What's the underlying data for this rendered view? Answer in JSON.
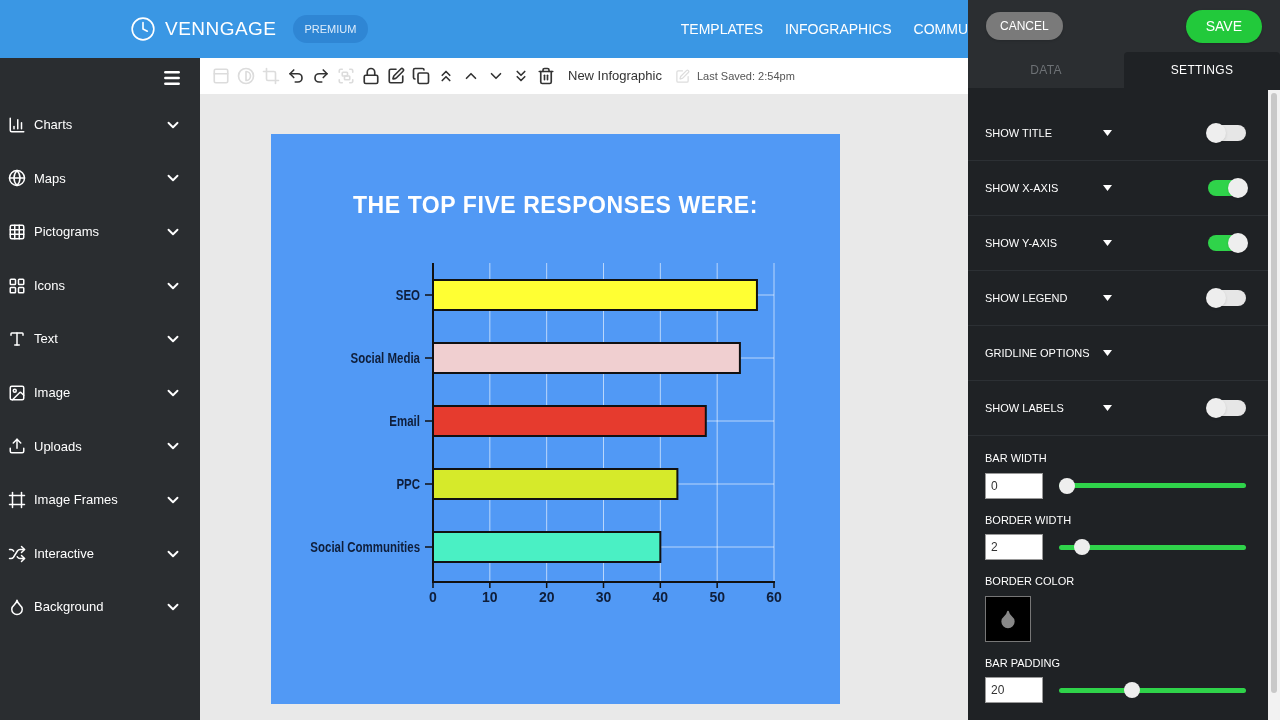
{
  "header": {
    "brand": "VENNGAGE",
    "badge": "PREMIUM",
    "nav": [
      "TEMPLATES",
      "INFOGRAPHICS",
      "COMMU"
    ]
  },
  "sidebar": {
    "items": [
      {
        "kind": "charts",
        "label": "Charts"
      },
      {
        "kind": "maps",
        "label": "Maps"
      },
      {
        "kind": "pictograms",
        "label": "Pictograms"
      },
      {
        "kind": "icons",
        "label": "Icons"
      },
      {
        "kind": "text",
        "label": "Text"
      },
      {
        "kind": "image",
        "label": "Image"
      },
      {
        "kind": "uploads",
        "label": "Uploads"
      },
      {
        "kind": "frames",
        "label": "Image Frames"
      },
      {
        "kind": "interactive",
        "label": "Interactive"
      },
      {
        "kind": "background",
        "label": "Background"
      }
    ]
  },
  "toolbar": {
    "tools": [
      {
        "kind": "align",
        "disabled": true
      },
      {
        "kind": "transparency",
        "disabled": true
      },
      {
        "kind": "crop",
        "disabled": true
      },
      {
        "kind": "undo",
        "disabled": false
      },
      {
        "kind": "redo",
        "disabled": false
      },
      {
        "kind": "group",
        "disabled": true
      },
      {
        "kind": "lock",
        "disabled": false
      },
      {
        "kind": "edit",
        "disabled": false
      },
      {
        "kind": "copy",
        "disabled": false
      },
      {
        "kind": "front",
        "disabled": false
      },
      {
        "kind": "forward",
        "disabled": false
      },
      {
        "kind": "backward",
        "disabled": false
      },
      {
        "kind": "back",
        "disabled": false
      },
      {
        "kind": "delete",
        "disabled": false
      }
    ],
    "document_name": "New Infographic",
    "last_saved": "Last Saved: 2:54pm"
  },
  "infographic": {
    "title": "THE TOP FIVE RESPONSES WERE:",
    "chart_data": {
      "type": "bar",
      "orientation": "horizontal",
      "categories": [
        "SEO",
        "Social Media",
        "Email",
        "PPC",
        "Social Communities"
      ],
      "series": [
        {
          "color": "#ffff33",
          "values": [
            57,
            null,
            null,
            null,
            null
          ]
        },
        {
          "color": "#f0cfd0",
          "values": [
            null,
            54,
            null,
            null,
            null
          ]
        },
        {
          "color": "#e63b2e",
          "values": [
            null,
            null,
            48,
            null,
            null
          ]
        },
        {
          "color": "#d6ea2a",
          "values": [
            null,
            null,
            null,
            43,
            null
          ]
        },
        {
          "color": "#4af0c4",
          "values": [
            null,
            null,
            null,
            null,
            40
          ]
        }
      ],
      "grid": true,
      "xlim": [
        0,
        60
      ],
      "xticks": [
        0,
        10,
        20,
        30,
        40,
        50,
        60
      ]
    }
  },
  "panel": {
    "cancel": "CANCEL",
    "save": "SAVE",
    "tabs": [
      {
        "label": "DATA",
        "selected": false
      },
      {
        "label": "SETTINGS",
        "selected": true
      }
    ],
    "settings": [
      {
        "kind": "toggle",
        "label": "SHOW TITLE",
        "on": false
      },
      {
        "kind": "toggle",
        "label": "SHOW X-AXIS",
        "on": true
      },
      {
        "kind": "toggle",
        "label": "SHOW Y-AXIS",
        "on": true
      },
      {
        "kind": "toggle",
        "label": "SHOW LEGEND",
        "on": false
      },
      {
        "kind": "dropdown",
        "label": "GRIDLINE OPTIONS"
      },
      {
        "kind": "toggle",
        "label": "SHOW LABELS",
        "on": false
      }
    ],
    "controls": [
      {
        "kind": "slider",
        "label": "BAR WIDTH",
        "value": "0",
        "level": 0
      },
      {
        "kind": "slider",
        "label": "BORDER WIDTH",
        "value": "2",
        "level": 0.09
      },
      {
        "kind": "color",
        "label": "BORDER COLOR"
      },
      {
        "kind": "slider",
        "label": "BAR PADDING",
        "value": "20",
        "level": 0.38
      }
    ]
  }
}
